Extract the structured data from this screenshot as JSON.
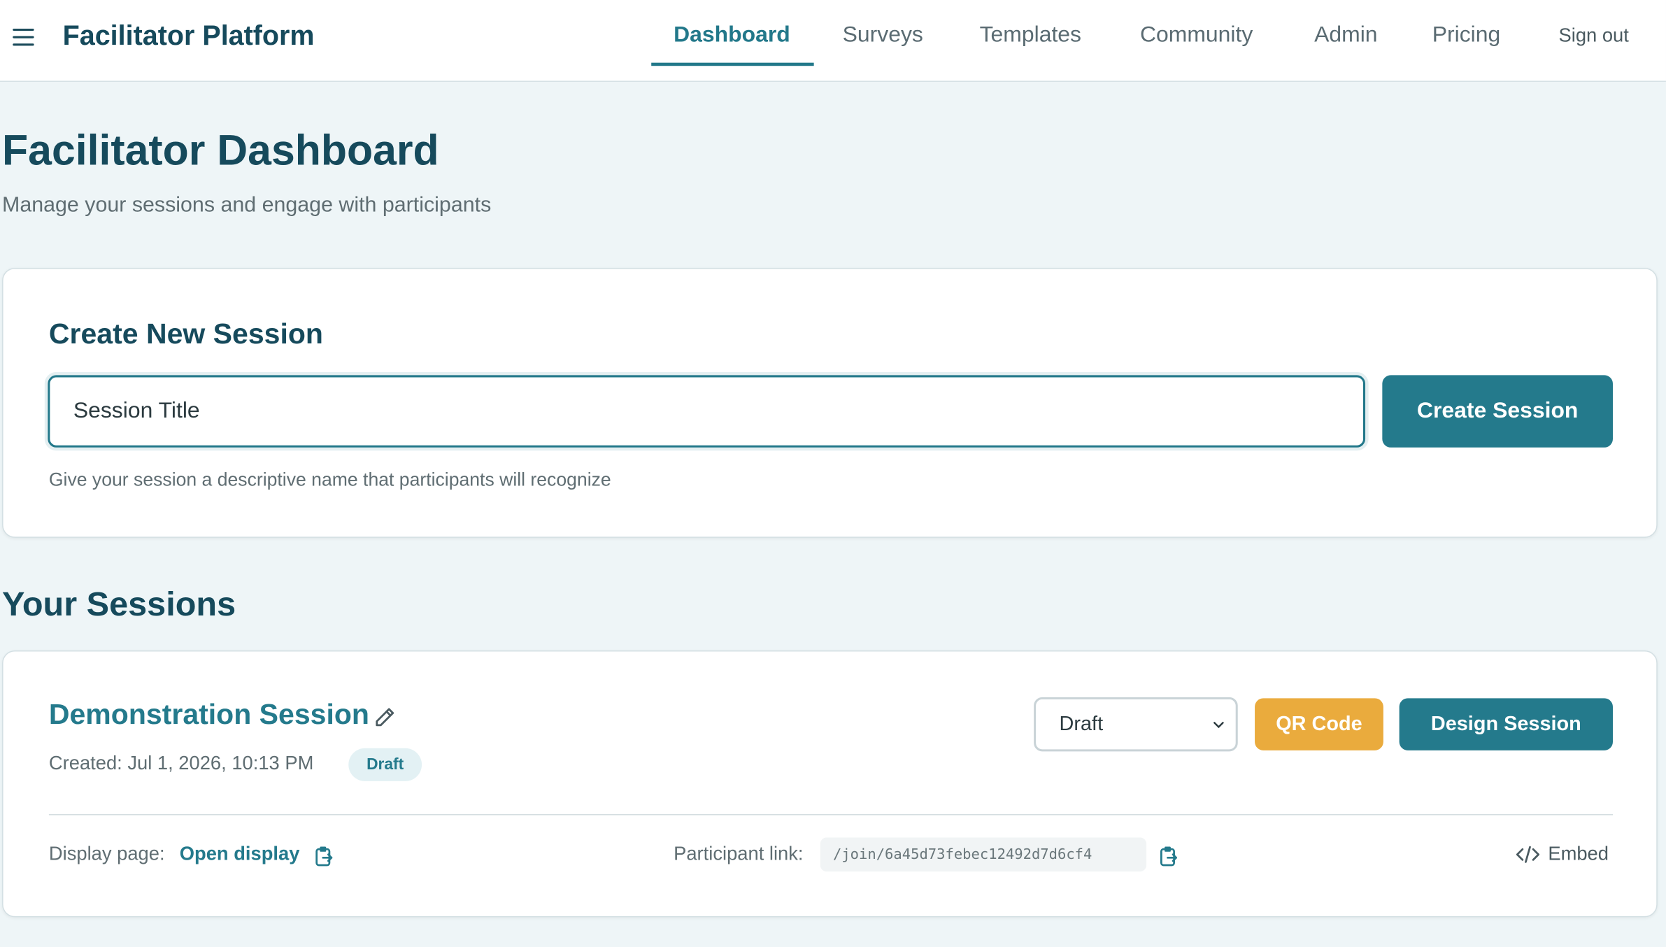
{
  "header": {
    "brand": "Facilitator Platform",
    "nav": [
      {
        "label": "Dashboard",
        "active": true
      },
      {
        "label": "Surveys"
      },
      {
        "label": "Templates"
      },
      {
        "label": "Community"
      },
      {
        "label": "Admin"
      },
      {
        "label": "Pricing"
      }
    ],
    "sign_out": "Sign out"
  },
  "page": {
    "title": "Facilitator Dashboard",
    "subtitle": "Manage your sessions and engage with participants"
  },
  "create": {
    "title": "Create New Session",
    "input_placeholder": "Session Title",
    "button": "Create Session",
    "hint": "Give your session a descriptive name that participants will recognize"
  },
  "sessions": {
    "title": "Your Sessions",
    "items": [
      {
        "name": "Demonstration Session",
        "created": "Created: Jul 1, 2026, 10:13 PM",
        "badge": "Draft",
        "status_value": "Draft",
        "qr_button": "QR Code",
        "design_button": "Design Session",
        "display_label": "Display page:",
        "display_link": "Open display",
        "participant_label": "Participant link:",
        "participant_link": "/join/6a45d73febec12492d7d6cf4",
        "embed": "Embed"
      }
    ]
  },
  "colors": {
    "accent": "#247a8c",
    "heading": "#164a5c",
    "qr_button": "#eaab3d",
    "background": "#eef5f7"
  },
  "icons": [
    "menu-icon",
    "pencil-icon",
    "copy-icon",
    "chevron-down-icon",
    "code-icon"
  ]
}
